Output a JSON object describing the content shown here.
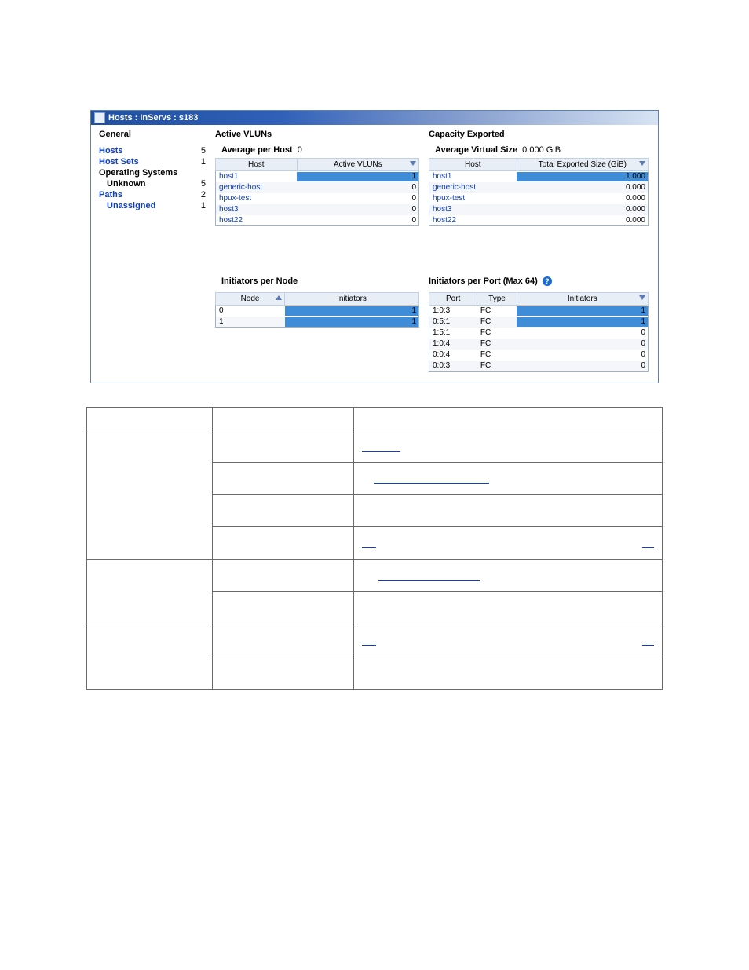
{
  "window": {
    "title": "Hosts : InServs : s183"
  },
  "general": {
    "title": "General",
    "items": [
      {
        "label": "Hosts",
        "value": "5",
        "link": true,
        "indent": 0
      },
      {
        "label": "Host Sets",
        "value": "1",
        "link": true,
        "indent": 0
      },
      {
        "label": "Operating Systems",
        "value": "",
        "link": false,
        "indent": 0
      },
      {
        "label": "Unknown",
        "value": "5",
        "link": false,
        "indent": 1
      },
      {
        "label": "Paths",
        "value": "2",
        "link": true,
        "indent": 0
      },
      {
        "label": "Unassigned",
        "value": "1",
        "link": true,
        "indent": 1
      }
    ]
  },
  "active_vluns": {
    "title": "Active VLUNs",
    "avg_label": "Average per Host",
    "avg_value": "0",
    "cols": [
      "Host",
      "Active VLUNs"
    ],
    "rows": [
      {
        "host": "host1",
        "value": "1",
        "bar": 100
      },
      {
        "host": "generic-host",
        "value": "0",
        "bar": 0
      },
      {
        "host": "hpux-test",
        "value": "0",
        "bar": 0
      },
      {
        "host": "host3",
        "value": "0",
        "bar": 0
      },
      {
        "host": "host22",
        "value": "0",
        "bar": 0
      }
    ]
  },
  "capacity": {
    "title": "Capacity Exported",
    "avg_label": "Average Virtual Size",
    "avg_value": "0.000 GiB",
    "cols": [
      "Host",
      "Total Exported Size (GiB)"
    ],
    "rows": [
      {
        "host": "host1",
        "value": "1.000",
        "bar": 100
      },
      {
        "host": "generic-host",
        "value": "0.000",
        "bar": 0
      },
      {
        "host": "hpux-test",
        "value": "0.000",
        "bar": 0
      },
      {
        "host": "host3",
        "value": "0.000",
        "bar": 0
      },
      {
        "host": "host22",
        "value": "0.000",
        "bar": 0
      }
    ]
  },
  "init_node": {
    "title": "Initiators per Node",
    "cols": [
      "Node",
      "Initiators"
    ],
    "rows": [
      {
        "node": "0",
        "value": "1",
        "bar": 100
      },
      {
        "node": "1",
        "value": "1",
        "bar": 100
      }
    ]
  },
  "init_port": {
    "title": "Initiators per Port (Max 64)",
    "help": "?",
    "cols": [
      "Port",
      "Type",
      "Initiators"
    ],
    "rows": [
      {
        "port": "1:0:3",
        "type": "FC",
        "value": "1",
        "bar": 100
      },
      {
        "port": "0:5:1",
        "type": "FC",
        "value": "1",
        "bar": 100
      },
      {
        "port": "1:5:1",
        "type": "FC",
        "value": "0",
        "bar": 0
      },
      {
        "port": "1:0:4",
        "type": "FC",
        "value": "0",
        "bar": 0
      },
      {
        "port": "0:0:4",
        "type": "FC",
        "value": "0",
        "bar": 0
      },
      {
        "port": "0:0:3",
        "type": "FC",
        "value": "0",
        "bar": 0
      }
    ]
  }
}
